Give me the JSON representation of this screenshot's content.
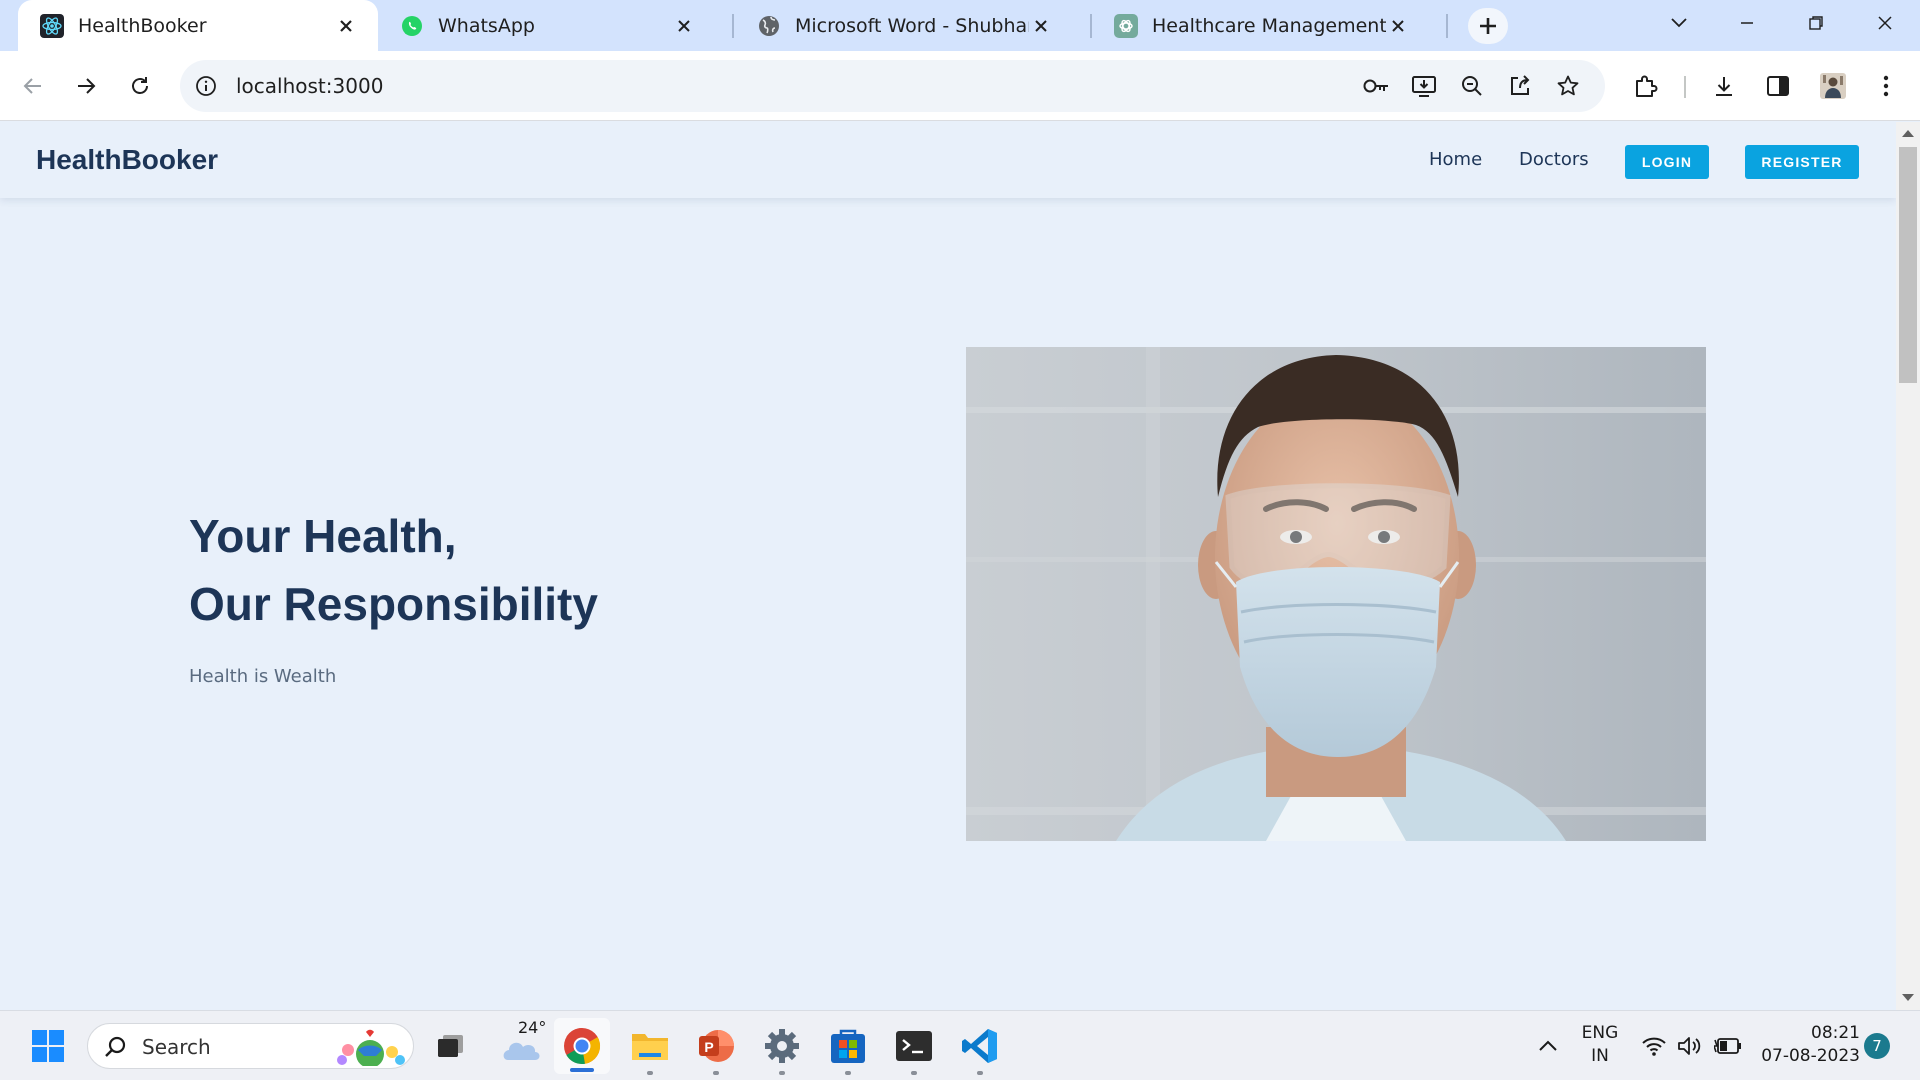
{
  "browser": {
    "tabs": [
      {
        "title": "HealthBooker",
        "icon": "react-icon",
        "active": true
      },
      {
        "title": "WhatsApp",
        "icon": "whatsapp-icon",
        "active": false
      },
      {
        "title": "Microsoft Word - Shubham fina",
        "icon": "globe-icon",
        "active": false
      },
      {
        "title": "Healthcare Management Platfo",
        "icon": "chatgpt-icon",
        "active": false
      }
    ],
    "url": "localhost:3000"
  },
  "page": {
    "brand": "HealthBooker",
    "nav": {
      "home": "Home",
      "doctors": "Doctors",
      "login": "LOGIN",
      "register": "REGISTER"
    },
    "hero": {
      "title_line1": "Your Health,",
      "title_line2": "Our Responsibility",
      "subtitle": "Health is Wealth",
      "image": "doctor-face-mask-photo"
    },
    "colors": {
      "brand_text": "#1d3557",
      "button": "#0aa3e0",
      "page_bg": "#e8f0fa"
    }
  },
  "taskbar": {
    "search_label": "Search",
    "weather_temp": "24°",
    "language_line1": "ENG",
    "language_line2": "IN",
    "time": "08:21",
    "date": "07-08-2023",
    "notification_count": "7"
  }
}
